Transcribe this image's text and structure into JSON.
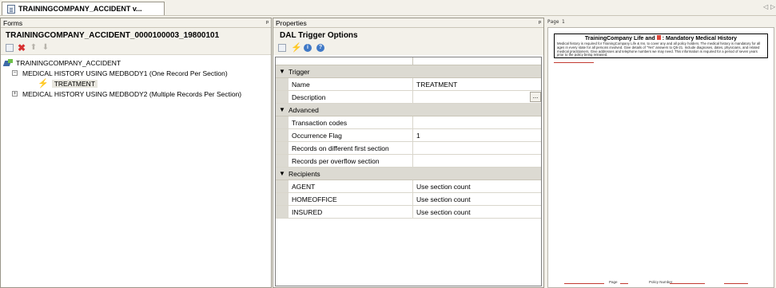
{
  "document_tab": {
    "label": "TRAININGCOMPANY_ACCIDENT v..."
  },
  "forms_panel": {
    "header": "Forms",
    "title": "TRAININGCOMPANY_ACCIDENT_0000100003_19800101",
    "root": "TRAININGCOMPANY_ACCIDENT",
    "items": [
      {
        "label": "MEDICAL HISTORY USING MEDBODY1 (One Record Per Section)",
        "expanded": true
      },
      {
        "label": "MEDICAL HISTORY USING MEDBODY2 (Multiple Records Per Section)",
        "expanded": false
      }
    ],
    "child": "TREATMENT"
  },
  "properties_panel": {
    "header": "Properties",
    "title": "DAL Trigger Options",
    "sections": [
      {
        "name": "Trigger",
        "rows": [
          {
            "name": "Name",
            "value": "TREATMENT"
          },
          {
            "name": "Description",
            "value": "",
            "ellipsis": "..."
          }
        ]
      },
      {
        "name": "Advanced",
        "rows": [
          {
            "name": "Transaction codes",
            "value": ""
          },
          {
            "name": "Occurrence Flag",
            "value": "1"
          },
          {
            "name": "Records on different first section",
            "value": ""
          },
          {
            "name": "Records per overflow section",
            "value": ""
          }
        ]
      },
      {
        "name": "Recipients",
        "rows": [
          {
            "name": "AGENT",
            "value": "Use section count"
          },
          {
            "name": "HOMEOFFICE",
            "value": "Use section count"
          },
          {
            "name": "INSURED",
            "value": "Use section count"
          }
        ]
      }
    ]
  },
  "preview": {
    "page_label": "Page 1",
    "heading_a": "TrainingCompany Life and",
    "heading_b": ": Mandatory Medical History",
    "body": "Medical history is required for TrainingCompany Life & Ins. to cover any and all policy holders. The medical history is mandatory for all ages in every state for all persons involved. Give details of \"Yes\" answers to Q5-21. Include diagnoses, dates, physicians, and related medical practitioners. Give addresses and telephone numbers we may need. This information is required for a period of seven years prior to the policy being released.",
    "footer_page": "Page",
    "footer_policy": "Policy Number"
  },
  "colors": {
    "accent_green": "#54c22a",
    "delete_red": "#d72f2f",
    "preview_red": "#c23a31"
  }
}
